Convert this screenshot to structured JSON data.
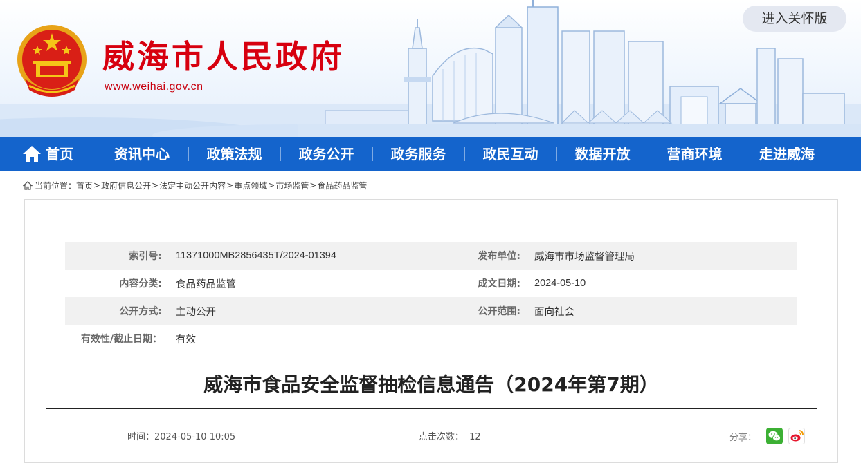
{
  "header": {
    "site_title": "威海市人民政府",
    "site_url": "www.weihai.gov.cn",
    "care_mode_label": "进入关怀版"
  },
  "nav": {
    "items": [
      {
        "label": "首页",
        "icon": "home-icon"
      },
      {
        "label": "资讯中心"
      },
      {
        "label": "政策法规"
      },
      {
        "label": "政务公开"
      },
      {
        "label": "政务服务"
      },
      {
        "label": "政民互动"
      },
      {
        "label": "数据开放"
      },
      {
        "label": "营商环境"
      },
      {
        "label": "走进威海"
      }
    ]
  },
  "breadcrumb": {
    "prefix": "当前位置：",
    "items": [
      "首页",
      "政府信息公开",
      "法定主动公开内容",
      "重点领域",
      "市场监管",
      "食品药品监管"
    ],
    "separator": ">"
  },
  "meta": {
    "index_label": "索引号:",
    "index_value": "11371000MB2856435T/2024-01394",
    "publisher_label": "发布单位:",
    "publisher_value": "威海市市场监督管理局",
    "category_label": "内容分类:",
    "category_value": "食品药品监管",
    "date_label": "成文日期:",
    "date_value": "2024-05-10",
    "mode_label": "公开方式:",
    "mode_value": "主动公开",
    "scope_label": "公开范围:",
    "scope_value": "面向社会",
    "validity_label": "有效性/截止日期：",
    "validity_value": "有效"
  },
  "article": {
    "title": "威海市食品安全监督抽检信息通告（2024年第7期）",
    "time_label": "时间：",
    "time_value": "2024-05-10 10:05",
    "clicks_label": "点击次数：",
    "clicks_value": "12",
    "share_label": "分享："
  },
  "colors": {
    "brand_red": "#d7000f",
    "nav_blue": "#1464cc",
    "wechat_green": "#3cb034",
    "weibo_red": "#e6162d"
  }
}
